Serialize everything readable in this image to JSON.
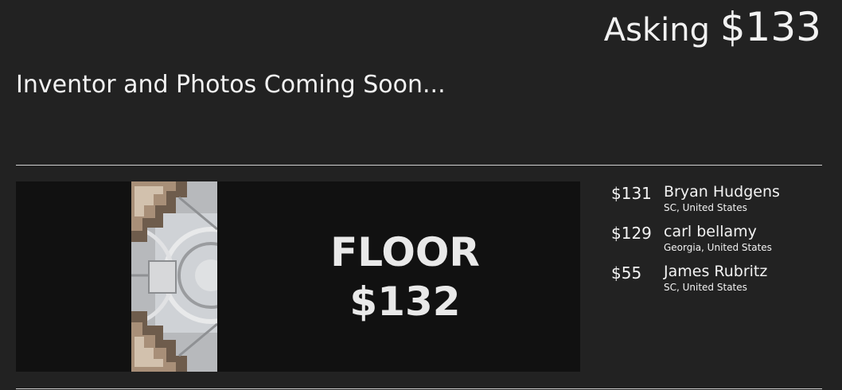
{
  "header": {
    "asking_label": "Asking",
    "asking_amount": "$133"
  },
  "subtitle": "Inventor and Photos Coming Soon...",
  "floor": {
    "label": "FLOOR",
    "amount": "$132"
  },
  "bids": [
    {
      "amount": "$131",
      "name": "Bryan Hudgens",
      "location": "SC, United States"
    },
    {
      "amount": "$129",
      "name": "carl bellamy",
      "location": "Georgia, United States"
    },
    {
      "amount": "$55",
      "name": "James Rubritz",
      "location": "SC, United States"
    }
  ],
  "colors": {
    "background": "#222222",
    "panel": "#111111",
    "text": "#f2f2f2"
  }
}
